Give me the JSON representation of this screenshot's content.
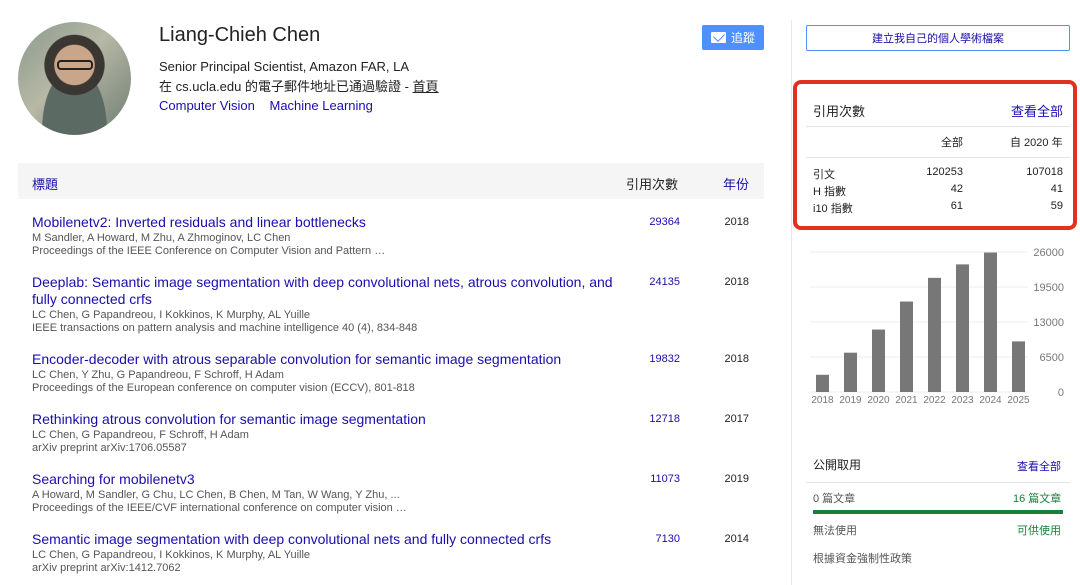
{
  "profile": {
    "name": "Liang-Chieh Chen",
    "affiliation": "Senior Principal Scientist, Amazon FAR, LA",
    "email_text": "在 cs.ucla.edu 的電子郵件地址已通過驗證 - ",
    "homepage_label": "首頁",
    "interests": [
      "Computer Vision",
      "Machine Learning"
    ],
    "follow_label": "追蹤"
  },
  "table": {
    "header": {
      "title": "標題",
      "cited_by": "引用次數",
      "year": "年份"
    },
    "articles": [
      {
        "title": "Mobilenetv2: Inverted residuals and linear bottlenecks",
        "authors": "M Sandler, A Howard, M Zhu, A Zhmoginov, LC Chen",
        "venue": "Proceedings of the IEEE Conference on Computer Vision and Pattern …",
        "cited": "29364",
        "year": "2018"
      },
      {
        "title": "Deeplab: Semantic image segmentation with deep convolutional nets, atrous convolution, and fully connected crfs",
        "authors": "LC Chen, G Papandreou, I Kokkinos, K Murphy, AL Yuille",
        "venue": "IEEE transactions on pattern analysis and machine intelligence 40 (4), 834-848",
        "cited": "24135",
        "year": "2018"
      },
      {
        "title": "Encoder-decoder with atrous separable convolution for semantic image segmentation",
        "authors": "LC Chen, Y Zhu, G Papandreou, F Schroff, H Adam",
        "venue": "Proceedings of the European conference on computer vision (ECCV), 801-818",
        "cited": "19832",
        "year": "2018"
      },
      {
        "title": "Rethinking atrous convolution for semantic image segmentation",
        "authors": "LC Chen, G Papandreou, F Schroff, H Adam",
        "venue": "arXiv preprint arXiv:1706.05587",
        "cited": "12718",
        "year": "2017"
      },
      {
        "title": "Searching for mobilenetv3",
        "authors": "A Howard, M Sandler, G Chu, LC Chen, B Chen, M Tan, W Wang, Y Zhu, ...",
        "venue": "Proceedings of the IEEE/CVF international conference on computer vision …",
        "cited": "11073",
        "year": "2019"
      },
      {
        "title": "Semantic image segmentation with deep convolutional nets and fully connected crfs",
        "authors": "LC Chen, G Papandreou, I Kokkinos, K Murphy, AL Yuille",
        "venue": "arXiv preprint arXiv:1412.7062",
        "cited": "7130",
        "year": "2014"
      }
    ]
  },
  "sidebar": {
    "build_profile_label": "建立我自己的個人學術檔案",
    "citations": {
      "heading": "引用次數",
      "view_all": "查看全部",
      "col_all": "全部",
      "col_since": "自 2020 年",
      "rows": [
        {
          "label": "引文",
          "all": "120253",
          "since": "107018"
        },
        {
          "label": "H 指數",
          "all": "42",
          "since": "41"
        },
        {
          "label": "i10 指數",
          "all": "61",
          "since": "59"
        }
      ]
    },
    "open_access": {
      "heading": "公開取用",
      "view_all": "查看全部",
      "unavailable_count": "0 篇文章",
      "available_count": "16 篇文章",
      "unavailable_label": "無法使用",
      "available_label": "可供使用",
      "policy_label": "根據資金強制性政策",
      "bar_color": "#188038"
    }
  },
  "chart_data": {
    "type": "bar",
    "categories": [
      "2018",
      "2019",
      "2020",
      "2021",
      "2022",
      "2023",
      "2024",
      "2025"
    ],
    "values": [
      3200,
      7300,
      11600,
      16800,
      21200,
      23700,
      25900,
      9400
    ],
    "yticks": [
      "26000",
      "19500",
      "13000",
      "6500",
      "0"
    ],
    "ylim": [
      0,
      26000
    ],
    "bar_color": "#777777"
  }
}
